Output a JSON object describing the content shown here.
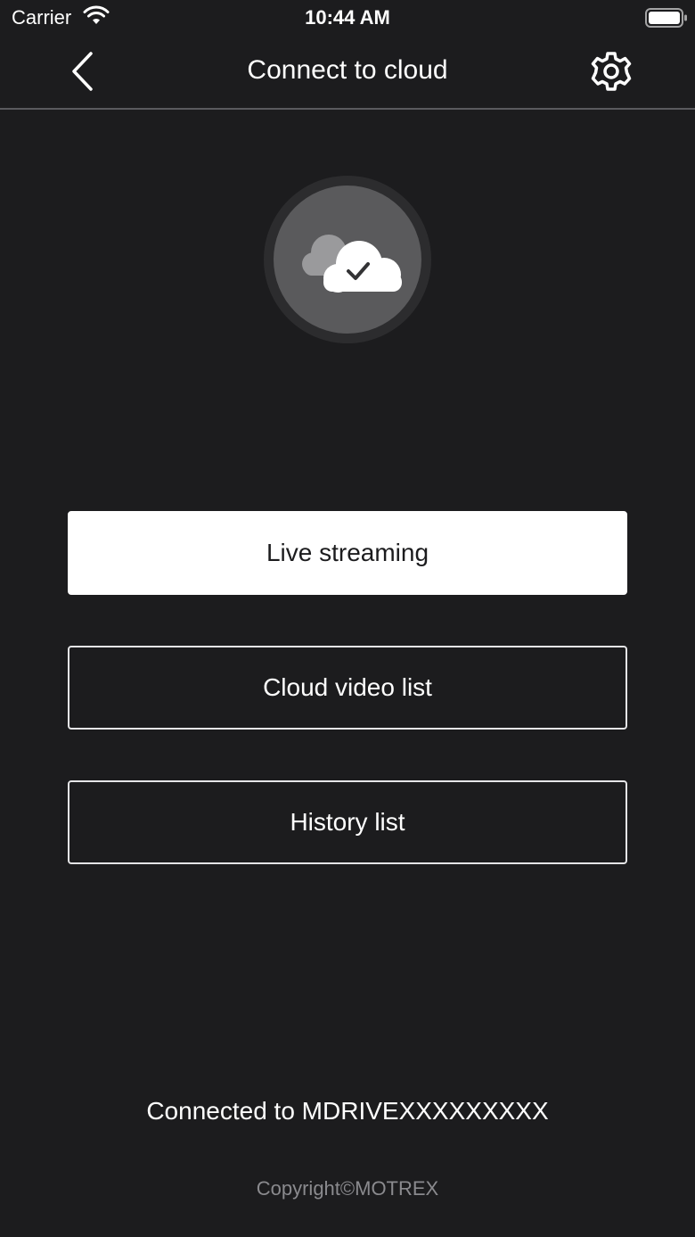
{
  "status_bar": {
    "carrier": "Carrier",
    "time": "10:44 AM",
    "wifi_icon": "wifi-icon",
    "battery_icon": "battery-full-icon"
  },
  "nav": {
    "title": "Connect to cloud",
    "back_icon": "chevron-left-icon",
    "settings_icon": "gear-icon"
  },
  "hero": {
    "icon": "cloud-check-icon"
  },
  "buttons": {
    "live_streaming": "Live streaming",
    "cloud_video_list": "Cloud video list",
    "history_list": "History list"
  },
  "footer": {
    "connection_status": "Connected to MDRIVEXXXXXXXXX",
    "copyright": "Copyright©MOTREX"
  },
  "colors": {
    "background": "#1c1c1e",
    "primary_button_bg": "#ffffff",
    "outline_border": "#e5e5e7",
    "badge_inner": "#5a5a5c",
    "copyright_text": "#8a8a8e"
  }
}
